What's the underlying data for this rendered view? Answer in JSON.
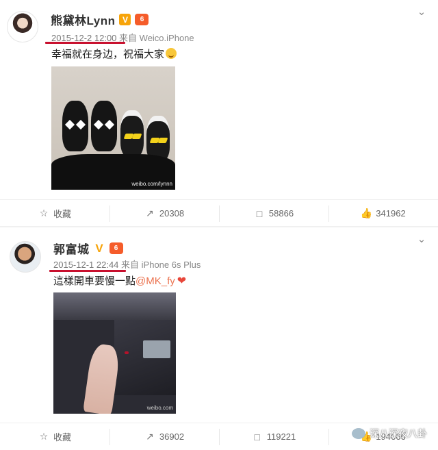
{
  "posts": [
    {
      "username": "熊黛林Lynn",
      "verified_mark": "V",
      "vip_mark": "6",
      "time": "2015-12-2 12:00",
      "source": "来自 Weico.iPhone",
      "text": "幸福就在身边，祝福大家",
      "emoji": "smile-emoji",
      "image_watermark": "weibo.com/lynnn",
      "actions": {
        "favorite": "收藏",
        "repost_count": "20308",
        "comment_count": "58866",
        "like_count": "341962"
      }
    },
    {
      "username": "郭富城",
      "verified_mark": "V",
      "vip_mark": "6",
      "time": "2015-12-1 22:44",
      "source": "来自 iPhone 6s Plus",
      "text": "這樣開車要慢一點",
      "mention": "@MK_fy",
      "emoji": "heart-emoji",
      "image_watermark": "weibo.com",
      "actions": {
        "favorite": "收藏",
        "repost_count": "36902",
        "comment_count": "119221",
        "like_count": "194666"
      }
    }
  ],
  "watermark_brand": "深八深夜八卦",
  "colors": {
    "underline": "#c8102e",
    "mention": "#eb7350",
    "verified": "#f7a40a"
  }
}
